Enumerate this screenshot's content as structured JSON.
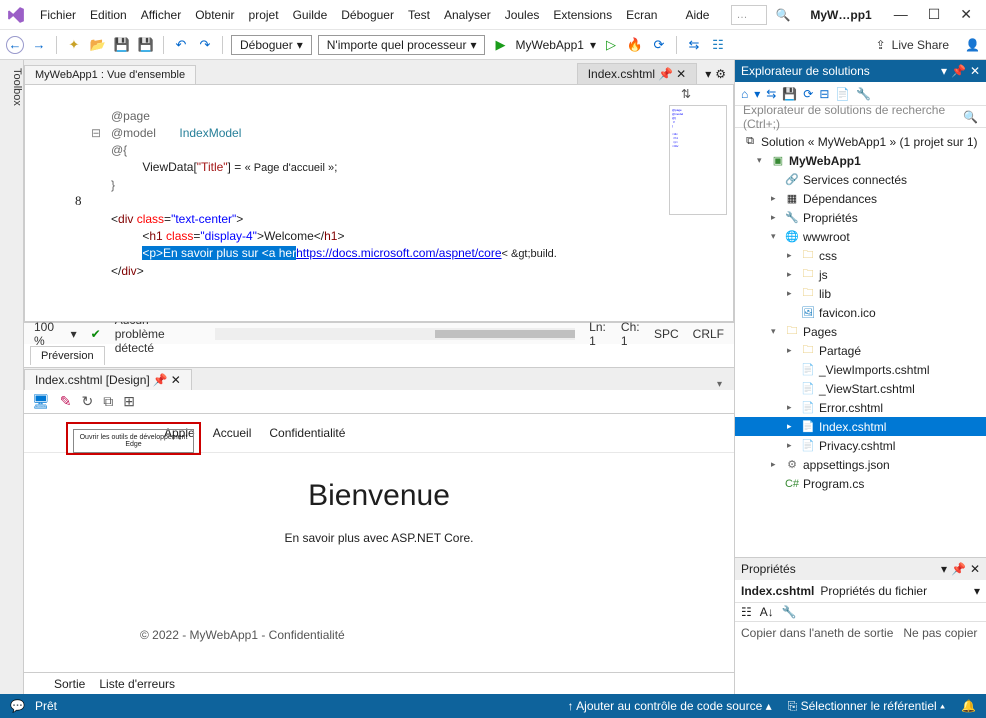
{
  "app": {
    "title": "MyW…pp1"
  },
  "menu": [
    "Fichier",
    "Edition",
    "Afficher",
    "Obtenir",
    "projet",
    "Guilde",
    "Déboguer",
    "Test",
    "Analyser",
    "Joules",
    "Extensions",
    "Ecran",
    "Aide"
  ],
  "search_placeholder": "…",
  "toolbar": {
    "debug_label": "Déboguer",
    "processor_label": "N'importe quel processeur",
    "run_target": "MyWebApp1",
    "liveshare": "Live Share"
  },
  "toolbox_label": "Toolbox",
  "tabs": {
    "overview": "MyWebApp1 : Vue d'ensemble",
    "index": "Index.cshtml"
  },
  "code": {
    "l1a": "@page",
    "l2a": "@model",
    "l2b": "IndexModel",
    "l3a": "@{",
    "l4a": "ViewData[",
    "l4b": "\"Title\"",
    "l4c": "] = ",
    "l4d": "« Page d'accueil »",
    "l4e": ";",
    "l5a": "}",
    "l6num": "8",
    "l6a": "<",
    "l6b": "div",
    "l6c": " class",
    "l6d": "=",
    "l6e": "\"text-center\"",
    "l6f": ">",
    "l7a": "<",
    "l7b": "h1",
    "l7c": " class",
    "l7d": "=",
    "l7e": "\"display-4\"",
    "l7f": ">Welcome</",
    "l7g": "h1",
    "l7h": ">",
    "l8sel": "<p>En savoir plus sur <a her",
    "l8link": "https://docs.microsoft.com/aspnet/core",
    "l8end": "< &gt;build.",
    "l9a": "</",
    "l9b": "div",
    "l9c": ">"
  },
  "editor_status": {
    "zoom": "100 %",
    "issues": "Aucun problème détecté",
    "ln": "Ln: 1",
    "ch": "Ch: 1",
    "spc": "SPC",
    "crlf": "CRLF",
    "preview_tab": "Préversion"
  },
  "design": {
    "tab": "Index.cshtml [Design]",
    "edge_tooltip": "Ouvrir les outils de développement Edge",
    "nav": [
      "Apple",
      "Accueil",
      "Confidentialité"
    ],
    "welcome_h": "Bienvenue",
    "welcome_p": "En savoir plus avec ASP.NET Core.",
    "footer": "© 2022 - MyWebApp1 - Confidentialité"
  },
  "output_tabs": [
    "Sortie",
    "Liste d'erreurs"
  ],
  "solution": {
    "header": "Explorateur de solutions",
    "search": "Explorateur de solutions de recherche (Ctrl+;)",
    "root": "Solution « MyWebApp1 » (1 projet sur 1)",
    "project": "MyWebApp1",
    "connected": "Services connectés",
    "deps": "Dépendances",
    "props": "Propriétés",
    "wwwroot": "wwwroot",
    "css": "css",
    "js": "js",
    "lib": "lib",
    "favicon": "favicon.ico",
    "pages": "Pages",
    "shared": "Partagé",
    "viewimports": "_ViewImports.cshtml",
    "viewstart": "_ViewStart.cshtml",
    "error": "Error.cshtml",
    "index": "Index.cshtml",
    "privacy": "Privacy.cshtml",
    "appsettings": "appsettings.json",
    "program": "Program.cs"
  },
  "properties": {
    "header": "Propriétés",
    "file": "Index.cshtml",
    "file_sub": "Propriétés du fichier",
    "copy_lbl": "Copier dans l'aneth de sortie",
    "copy_val": "Ne pas copier"
  },
  "status": {
    "ready": "Prêt",
    "add_src": "Ajouter au contrôle de code source",
    "select_repo": "Sélectionner le référentiel"
  }
}
